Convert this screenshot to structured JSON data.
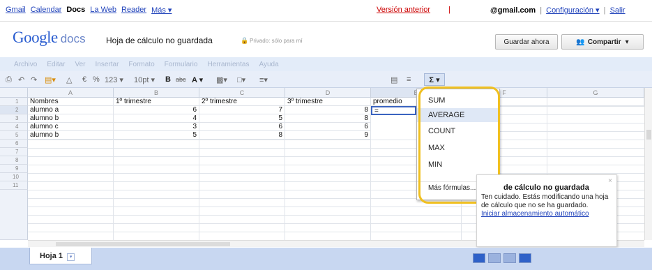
{
  "topnav": {
    "links": [
      "Gmail",
      "Calendar",
      "Docs",
      "La Web",
      "Reader",
      "Más ▾"
    ],
    "previous_version": "Versión anterior",
    "separator": "|",
    "email": "@gmail.com",
    "settings": "Configuración ▾",
    "sign_out": "Salir"
  },
  "header": {
    "logo_google": "Google",
    "logo_docs": "docs",
    "doc_title": "Hoja de cálculo no guardada",
    "privacy": "Privado: sólo para mí",
    "save_label": "Guardar ahora",
    "share_label": "Compartir"
  },
  "menubar": [
    "Archivo",
    "Editar",
    "Ver",
    "Insertar",
    "Formato",
    "Formulario",
    "Herramientas",
    "Ayuda"
  ],
  "toolbar": {
    "currency": "€",
    "percent": "%",
    "number_format": "123 ▾",
    "font_size": "10pt ▾",
    "bold": "B",
    "strike": "abc",
    "text_color": "A ▾",
    "sigma": "Σ ▾"
  },
  "grid": {
    "columns": [
      "A",
      "B",
      "C",
      "D",
      "E",
      "F",
      "G"
    ],
    "rows": [
      "1",
      "2",
      "3",
      "4",
      "5",
      "6",
      "7",
      "8",
      "9",
      "10",
      "11"
    ],
    "header_row": [
      "Nombres",
      "1º trimestre",
      "2º trimestre",
      "3º trimestre",
      "promedio"
    ],
    "data": [
      [
        "alumno a",
        "6",
        "7",
        "8"
      ],
      [
        "alumno b",
        "4",
        "5",
        "8"
      ],
      [
        "alumno c",
        "3",
        "6",
        "6"
      ],
      [
        "alumno b",
        "5",
        "8",
        "9"
      ]
    ],
    "active_cell_value": "="
  },
  "formula_menu": {
    "items": [
      "SUM",
      "AVERAGE",
      "COUNT",
      "MAX",
      "MIN"
    ],
    "hovered": "AVERAGE",
    "more": "Más fórmulas..."
  },
  "tooltip": {
    "title": "de cálculo no guardada",
    "body": "Ten cuidado. Estás modificando una hoja de cálculo que no se ha guardado.",
    "link": "Iniciar almacenamiento automático",
    "close": "×"
  },
  "sheetbar": {
    "tab_label": "Hoja 1",
    "tab_arrow": "▾"
  },
  "colors": {
    "accent": "#2f61c8",
    "highlight": "#f0c020",
    "toolbar_bg": "#e8eef9",
    "sheetbar_bg": "#c8d7f1"
  }
}
